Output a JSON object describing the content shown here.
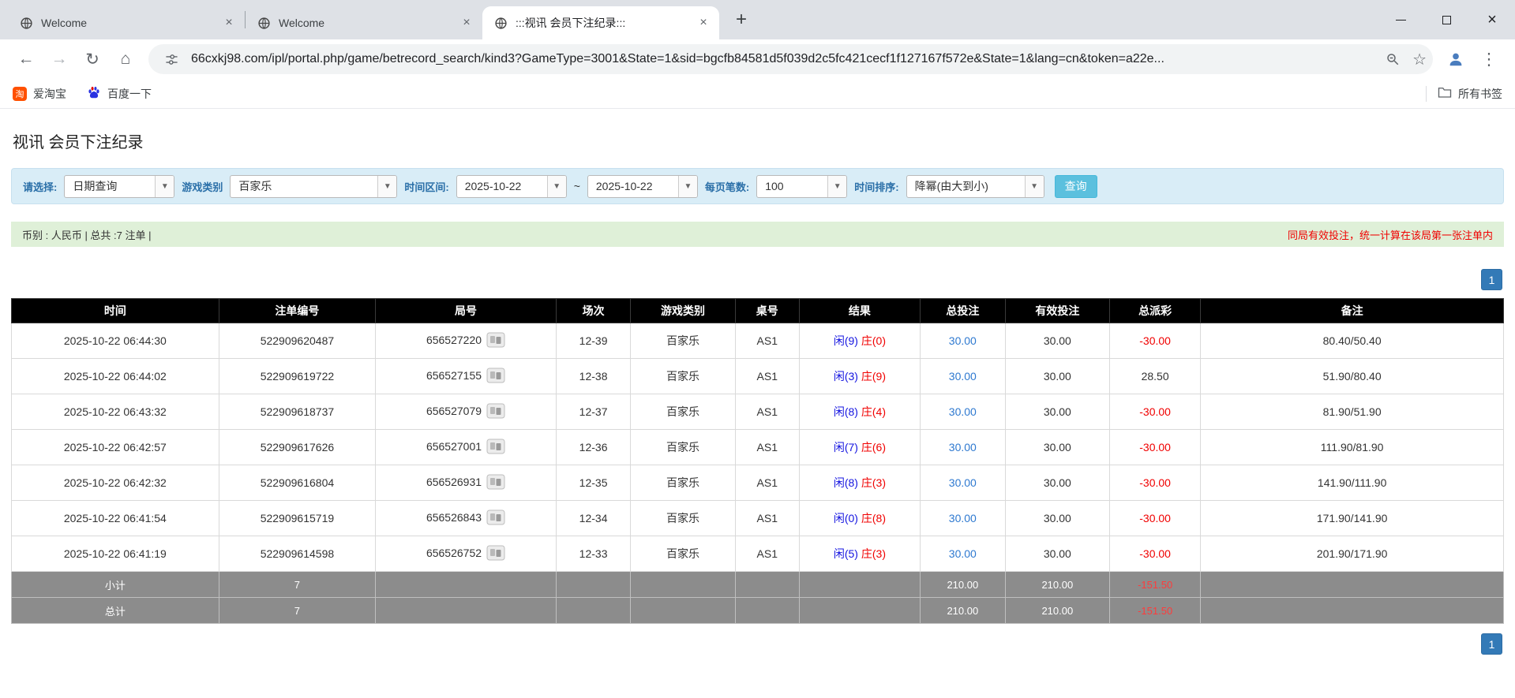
{
  "browser": {
    "tabs": [
      {
        "label": "Welcome"
      },
      {
        "label": "Welcome"
      },
      {
        "label": ":::视讯 会员下注纪录:::"
      }
    ],
    "new_tab": "+",
    "url": "66cxkj98.com/ipl/portal.php/game/betrecord_search/kind3?GameType=3001&State=1&sid=bgcfb84581d5f039d2c5fc421cecf1f127167f572e&State=1&lang=cn&token=a22e...",
    "bookmarks": {
      "taobao": "爱淘宝",
      "taobao_icon_glyph": "淘",
      "baidu": "百度一下",
      "all_bookmarks": "所有书签"
    }
  },
  "page": {
    "title": "视讯 会员下注纪录",
    "filter": {
      "query_type_label": "请选择:",
      "query_type_value": "日期查询",
      "game_type_label": "游戏类别",
      "game_type_value": "百家乐",
      "date_range_label": "时间区间:",
      "date_from": "2025-10-22",
      "range_separator": "~",
      "date_to": "2025-10-22",
      "per_page_label": "每页笔数:",
      "per_page_value": "100",
      "sort_label": "时间排序:",
      "sort_value": "降幂(由大到小)",
      "search_button_label": "查询"
    },
    "info_bar": {
      "summary": "币别 : 人民币 | 总共 :7 注单 |",
      "note": "同局有效投注，统一计算在该局第一张注单内"
    },
    "pagination": {
      "page": "1"
    },
    "table": {
      "headers": [
        "时间",
        "注单编号",
        "局号",
        "场次",
        "游戏类别",
        "桌号",
        "结果",
        "总投注",
        "有效投注",
        "总派彩",
        "备注"
      ],
      "rows": [
        {
          "time": "2025-10-22 06:44:30",
          "bet_id": "522909620487",
          "round": "656527220",
          "session": "12-39",
          "game": "百家乐",
          "table": "AS1",
          "result_player": "闲(9)",
          "result_banker": "庄(0)",
          "total_bet": "30.00",
          "valid_bet": "30.00",
          "payout": "-30.00",
          "remark": "80.40/50.40"
        },
        {
          "time": "2025-10-22 06:44:02",
          "bet_id": "522909619722",
          "round": "656527155",
          "session": "12-38",
          "game": "百家乐",
          "table": "AS1",
          "result_player": "闲(3)",
          "result_banker": "庄(9)",
          "total_bet": "30.00",
          "valid_bet": "30.00",
          "payout": "28.50",
          "remark": "51.90/80.40"
        },
        {
          "time": "2025-10-22 06:43:32",
          "bet_id": "522909618737",
          "round": "656527079",
          "session": "12-37",
          "game": "百家乐",
          "table": "AS1",
          "result_player": "闲(8)",
          "result_banker": "庄(4)",
          "total_bet": "30.00",
          "valid_bet": "30.00",
          "payout": "-30.00",
          "remark": "81.90/51.90"
        },
        {
          "time": "2025-10-22 06:42:57",
          "bet_id": "522909617626",
          "round": "656527001",
          "session": "12-36",
          "game": "百家乐",
          "table": "AS1",
          "result_player": "闲(7)",
          "result_banker": "庄(6)",
          "total_bet": "30.00",
          "valid_bet": "30.00",
          "payout": "-30.00",
          "remark": "111.90/81.90"
        },
        {
          "time": "2025-10-22 06:42:32",
          "bet_id": "522909616804",
          "round": "656526931",
          "session": "12-35",
          "game": "百家乐",
          "table": "AS1",
          "result_player": "闲(8)",
          "result_banker": "庄(3)",
          "total_bet": "30.00",
          "valid_bet": "30.00",
          "payout": "-30.00",
          "remark": "141.90/111.90"
        },
        {
          "time": "2025-10-22 06:41:54",
          "bet_id": "522909615719",
          "round": "656526843",
          "session": "12-34",
          "game": "百家乐",
          "table": "AS1",
          "result_player": "闲(0)",
          "result_banker": "庄(8)",
          "total_bet": "30.00",
          "valid_bet": "30.00",
          "payout": "-30.00",
          "remark": "171.90/141.90"
        },
        {
          "time": "2025-10-22 06:41:19",
          "bet_id": "522909614598",
          "round": "656526752",
          "session": "12-33",
          "game": "百家乐",
          "table": "AS1",
          "result_player": "闲(5)",
          "result_banker": "庄(3)",
          "total_bet": "30.00",
          "valid_bet": "30.00",
          "payout": "-30.00",
          "remark": "201.90/171.90"
        }
      ],
      "summary_rows": [
        {
          "label": "小计",
          "count": "7",
          "total_bet": "210.00",
          "valid_bet": "210.00",
          "payout": "-151.50"
        },
        {
          "label": "总计",
          "count": "7",
          "total_bet": "210.00",
          "valid_bet": "210.00",
          "payout": "-151.50"
        }
      ]
    }
  },
  "colors": {
    "accent_blue": "#337ab7",
    "link_blue": "#2e79d0",
    "player_blue": "#1414e0",
    "banker_red": "#f00000",
    "negative_red": "#f00000",
    "filter_bar_bg": "#d9edf7",
    "info_bar_bg": "#dff0d8",
    "table_header_bg": "#000000",
    "summary_row_bg": "#8c8c8c",
    "search_button_bg": "#5bc0de"
  }
}
